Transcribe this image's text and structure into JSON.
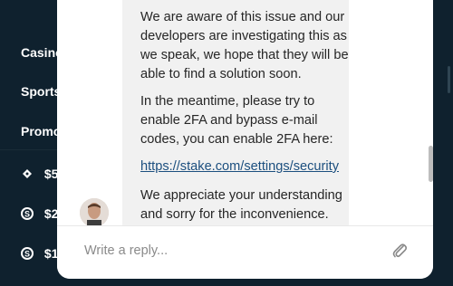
{
  "sidebar": {
    "items": [
      {
        "label": "Casino",
        "icon": "none"
      },
      {
        "label": "Sports",
        "icon": "none"
      },
      {
        "label": "Promo",
        "icon": "none"
      },
      {
        "label": "$5",
        "icon": "ticket-icon"
      },
      {
        "label": "$2",
        "icon": "stake-coin-icon"
      },
      {
        "label": "$1",
        "icon": "stake-coin-icon"
      }
    ]
  },
  "chat": {
    "messages": [
      "We are aware of this issue and our developers are investigating this as we speak, we hope that they will be able to find a solution soon.",
      "In the meantime, please try to enable 2FA and bypass e-mail codes, you can enable 2FA here:",
      "https://stake.com/settings/security",
      "We appreciate your understanding and sorry for the inconvenience."
    ],
    "reply_placeholder": "Write a reply..."
  },
  "colors": {
    "background": "#0f212e",
    "panel": "#ffffff",
    "bubble": "#f1f1f1",
    "link": "#1c4f7f"
  }
}
